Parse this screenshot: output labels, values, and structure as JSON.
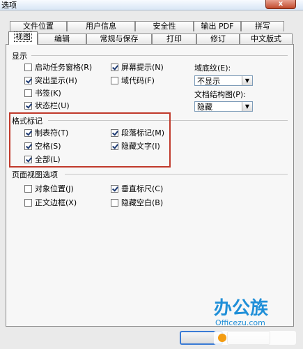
{
  "window": {
    "title": "选项",
    "close_symbol": "x"
  },
  "tabs_back": [
    "文件位置",
    "用户信息",
    "安全性",
    "输出 PDF",
    "拼写"
  ],
  "tabs_front": [
    "视图",
    "编辑",
    "常规与保存",
    "打印",
    "修订",
    "中文版式"
  ],
  "active_tab": "视图",
  "display_section": {
    "title": "显示",
    "checkboxes": [
      {
        "label": "启动任务窗格(R)",
        "checked": false
      },
      {
        "label": "屏幕提示(N)",
        "checked": true
      },
      {
        "label": "突出显示(H)",
        "checked": true
      },
      {
        "label": "域代码(F)",
        "checked": false
      },
      {
        "label": "书签(K)",
        "checked": false
      },
      {
        "label": "状态栏(U)",
        "checked": true
      }
    ],
    "field_shading": {
      "label": "域底纹(E):",
      "value": "不显示"
    },
    "doc_map": {
      "label": "文档结构图(P):",
      "value": "隐藏"
    }
  },
  "format_marks_section": {
    "title": "格式标记",
    "checkboxes": [
      {
        "label": "制表符(T)",
        "checked": true
      },
      {
        "label": "段落标记(M)",
        "checked": true
      },
      {
        "label": "空格(S)",
        "checked": true
      },
      {
        "label": "隐藏文字(I)",
        "checked": true
      },
      {
        "label": "全部(L)",
        "checked": true
      }
    ]
  },
  "page_view_section": {
    "title": "页面视图选项",
    "checkboxes": [
      {
        "label": "对象位置(J)",
        "checked": false
      },
      {
        "label": "垂直标尺(C)",
        "checked": true
      },
      {
        "label": "正文边框(X)",
        "checked": false
      },
      {
        "label": "隐藏空白(B)",
        "checked": false
      }
    ]
  },
  "watermark": {
    "text": "办公族",
    "subtext": "Officezu.com"
  },
  "colors": {
    "highlight_border": "#c0392b",
    "panel_bg": "#f7f7f7",
    "watermark_blue": "#1f8fd8"
  }
}
